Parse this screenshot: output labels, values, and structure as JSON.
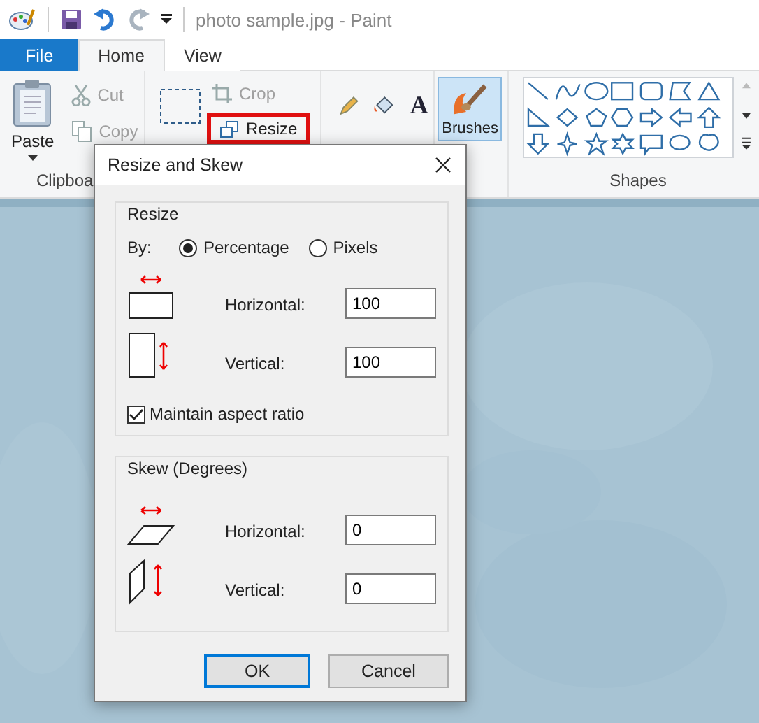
{
  "window": {
    "title": "photo sample.jpg - Paint"
  },
  "tabs": [
    {
      "label": "File",
      "kind": "file",
      "selected": false
    },
    {
      "label": "Home",
      "kind": "tab",
      "selected": true
    },
    {
      "label": "View",
      "kind": "tab",
      "selected": false
    }
  ],
  "ribbon": {
    "clipboard": {
      "paste": "Paste",
      "cut": {
        "label": "Cut",
        "disabled": true
      },
      "copy": {
        "label": "Copy",
        "disabled": true
      },
      "label": "Clipboa"
    },
    "image": {
      "crop": {
        "label": "Crop",
        "disabled": true
      },
      "resize": {
        "label": "Resize",
        "highlighted": true
      }
    },
    "tools": {
      "text": "A"
    },
    "brushes": {
      "label": "Brushes",
      "selected": true
    },
    "shapes": {
      "label": "Shapes"
    }
  },
  "dialog": {
    "title": "Resize and Skew",
    "resize": {
      "title": "Resize",
      "by_label": "By:",
      "units": [
        {
          "label": "Percentage",
          "selected": true
        },
        {
          "label": "Pixels",
          "selected": false
        }
      ],
      "fields": [
        {
          "kind": "horizontal",
          "label": "Horizontal:",
          "value": "100"
        },
        {
          "kind": "vertical",
          "label": "Vertical:",
          "value": "100"
        }
      ],
      "maintain": {
        "label": "Maintain aspect ratio",
        "checked": true
      }
    },
    "skew": {
      "title": "Skew (Degrees)",
      "fields": [
        {
          "kind": "horizontal",
          "label": "Horizontal:",
          "value": "0"
        },
        {
          "kind": "vertical",
          "label": "Vertical:",
          "value": "0"
        }
      ]
    },
    "buttons": [
      {
        "label": "OK",
        "default": true
      },
      {
        "label": "Cancel",
        "default": false
      }
    ]
  }
}
